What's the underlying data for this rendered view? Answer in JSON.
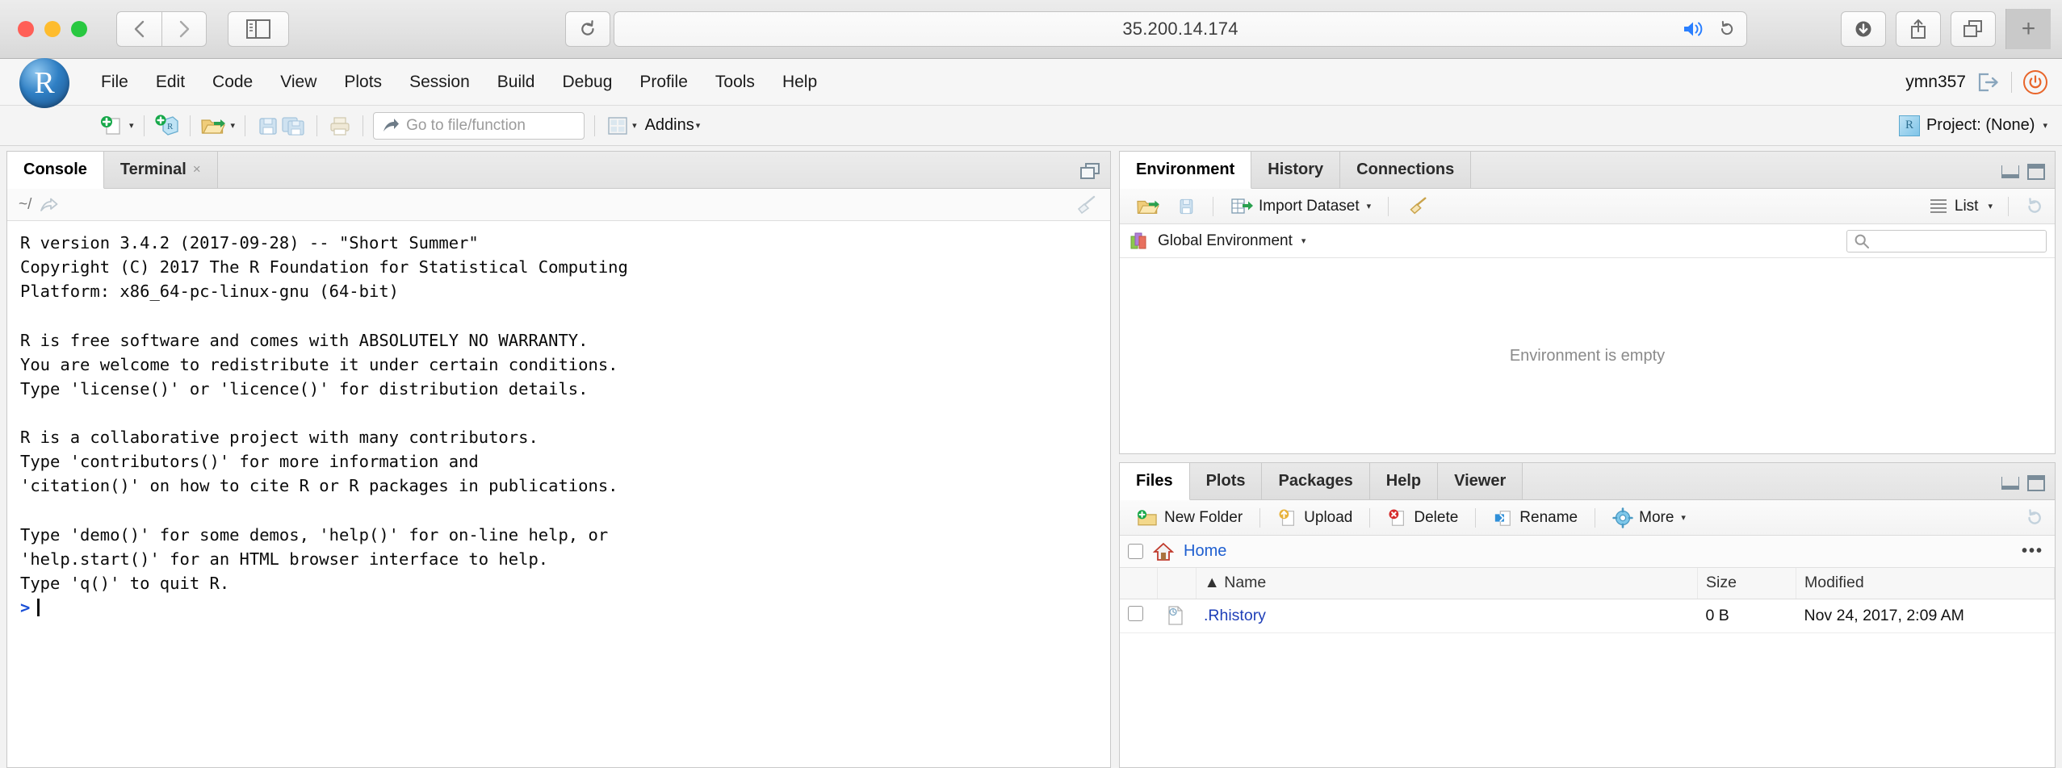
{
  "browser": {
    "url": "35.200.14.174",
    "back_label": "Back",
    "forward_label": "Forward",
    "sidebar_label": "Show Sidebar",
    "reload_label": "Reload",
    "downloads_label": "Downloads",
    "share_label": "Share",
    "tabs_label": "Show Tab Overview",
    "newtab_label": "+"
  },
  "rstudio": {
    "menu": [
      {
        "label": "File"
      },
      {
        "label": "Edit"
      },
      {
        "label": "Code"
      },
      {
        "label": "View"
      },
      {
        "label": "Plots"
      },
      {
        "label": "Session"
      },
      {
        "label": "Build"
      },
      {
        "label": "Debug"
      },
      {
        "label": "Profile"
      },
      {
        "label": "Tools"
      },
      {
        "label": "Help"
      }
    ],
    "user": "ymn357",
    "logo_letter": "R",
    "toolbar": {
      "goto_placeholder": "Go to file/function",
      "addins_label": "Addins",
      "project_label": "Project: (None)",
      "project_cube_letter": "R"
    }
  },
  "console_panel": {
    "tabs": [
      {
        "label": "Console",
        "active": true,
        "closable": false
      },
      {
        "label": "Terminal",
        "active": false,
        "closable": true,
        "close_glyph": "×"
      }
    ],
    "path": "~/",
    "output": "R version 3.4.2 (2017-09-28) -- \"Short Summer\"\nCopyright (C) 2017 The R Foundation for Statistical Computing\nPlatform: x86_64-pc-linux-gnu (64-bit)\n\nR is free software and comes with ABSOLUTELY NO WARRANTY.\nYou are welcome to redistribute it under certain conditions.\nType 'license()' or 'licence()' for distribution details.\n\nR is a collaborative project with many contributors.\nType 'contributors()' for more information and\n'citation()' on how to cite R or R packages in publications.\n\nType 'demo()' for some demos, 'help()' for on-line help, or\n'help.start()' for an HTML browser interface to help.\nType 'q()' to quit R.\n",
    "prompt": ">"
  },
  "environment_panel": {
    "tabs": [
      {
        "label": "Environment",
        "active": true
      },
      {
        "label": "History",
        "active": false
      },
      {
        "label": "Connections",
        "active": false
      }
    ],
    "toolbar": {
      "import_label": "Import Dataset",
      "view_mode": "List"
    },
    "scope": "Global Environment",
    "search_placeholder": "",
    "empty_message": "Environment is empty"
  },
  "files_panel": {
    "tabs": [
      {
        "label": "Files",
        "active": true
      },
      {
        "label": "Plots",
        "active": false
      },
      {
        "label": "Packages",
        "active": false
      },
      {
        "label": "Help",
        "active": false
      },
      {
        "label": "Viewer",
        "active": false
      }
    ],
    "toolbar": [
      {
        "label": "New Folder",
        "icon": "new-folder-icon"
      },
      {
        "label": "Upload",
        "icon": "upload-icon"
      },
      {
        "label": "Delete",
        "icon": "delete-icon"
      },
      {
        "label": "Rename",
        "icon": "rename-icon"
      },
      {
        "label": "More",
        "icon": "gear-icon"
      }
    ],
    "breadcrumb": "Home",
    "overflow_glyph": "•••",
    "columns": [
      "Name",
      "Size",
      "Modified"
    ],
    "sort_glyph": "▲",
    "rows": [
      {
        "name": ".Rhistory",
        "size": "0 B",
        "modified": "Nov 24, 2017, 2:09 AM"
      }
    ]
  }
}
